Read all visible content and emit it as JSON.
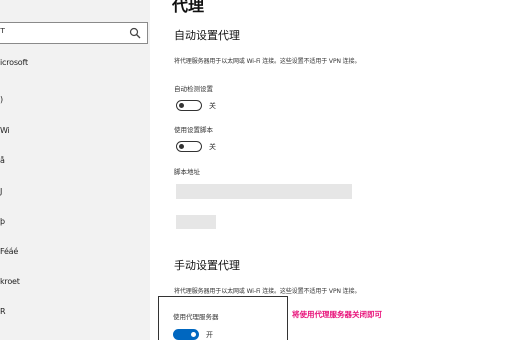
{
  "sidebar": {
    "search_text": "т",
    "items": [
      {
        "label": "icrosoft"
      },
      {
        "label": ")"
      },
      {
        "label": "Wi"
      },
      {
        "label": "å"
      },
      {
        "label": "J"
      },
      {
        "label": "þ"
      },
      {
        "label": "Féáé"
      },
      {
        "label": "kroet"
      },
      {
        "label": "R"
      }
    ]
  },
  "main": {
    "page_title": "代理",
    "auto_section": {
      "title": "自动设置代理",
      "description": "将代理服务器用于以太网或 Wi-Fi 连接。这些设置不适用于 VPN 连接。",
      "auto_detect_label": "自动检测设置",
      "auto_detect_state": "关",
      "use_script_label": "使用设置脚本",
      "use_script_state": "关",
      "script_address_label": "脚本地址"
    },
    "manual_section": {
      "title": "手动设置代理",
      "description": "将代理服务器用于以太网或 Wi-Fi 连接。这些设置不适用于 VPN 连接。",
      "use_proxy_label": "使用代理服务器",
      "use_proxy_state": "开"
    },
    "annotation": "将使用代理服务器关闭即可"
  },
  "colors": {
    "accent": "#0067c0",
    "annotation": "#e8127a",
    "sidebar_bg": "#f2f2f2"
  }
}
